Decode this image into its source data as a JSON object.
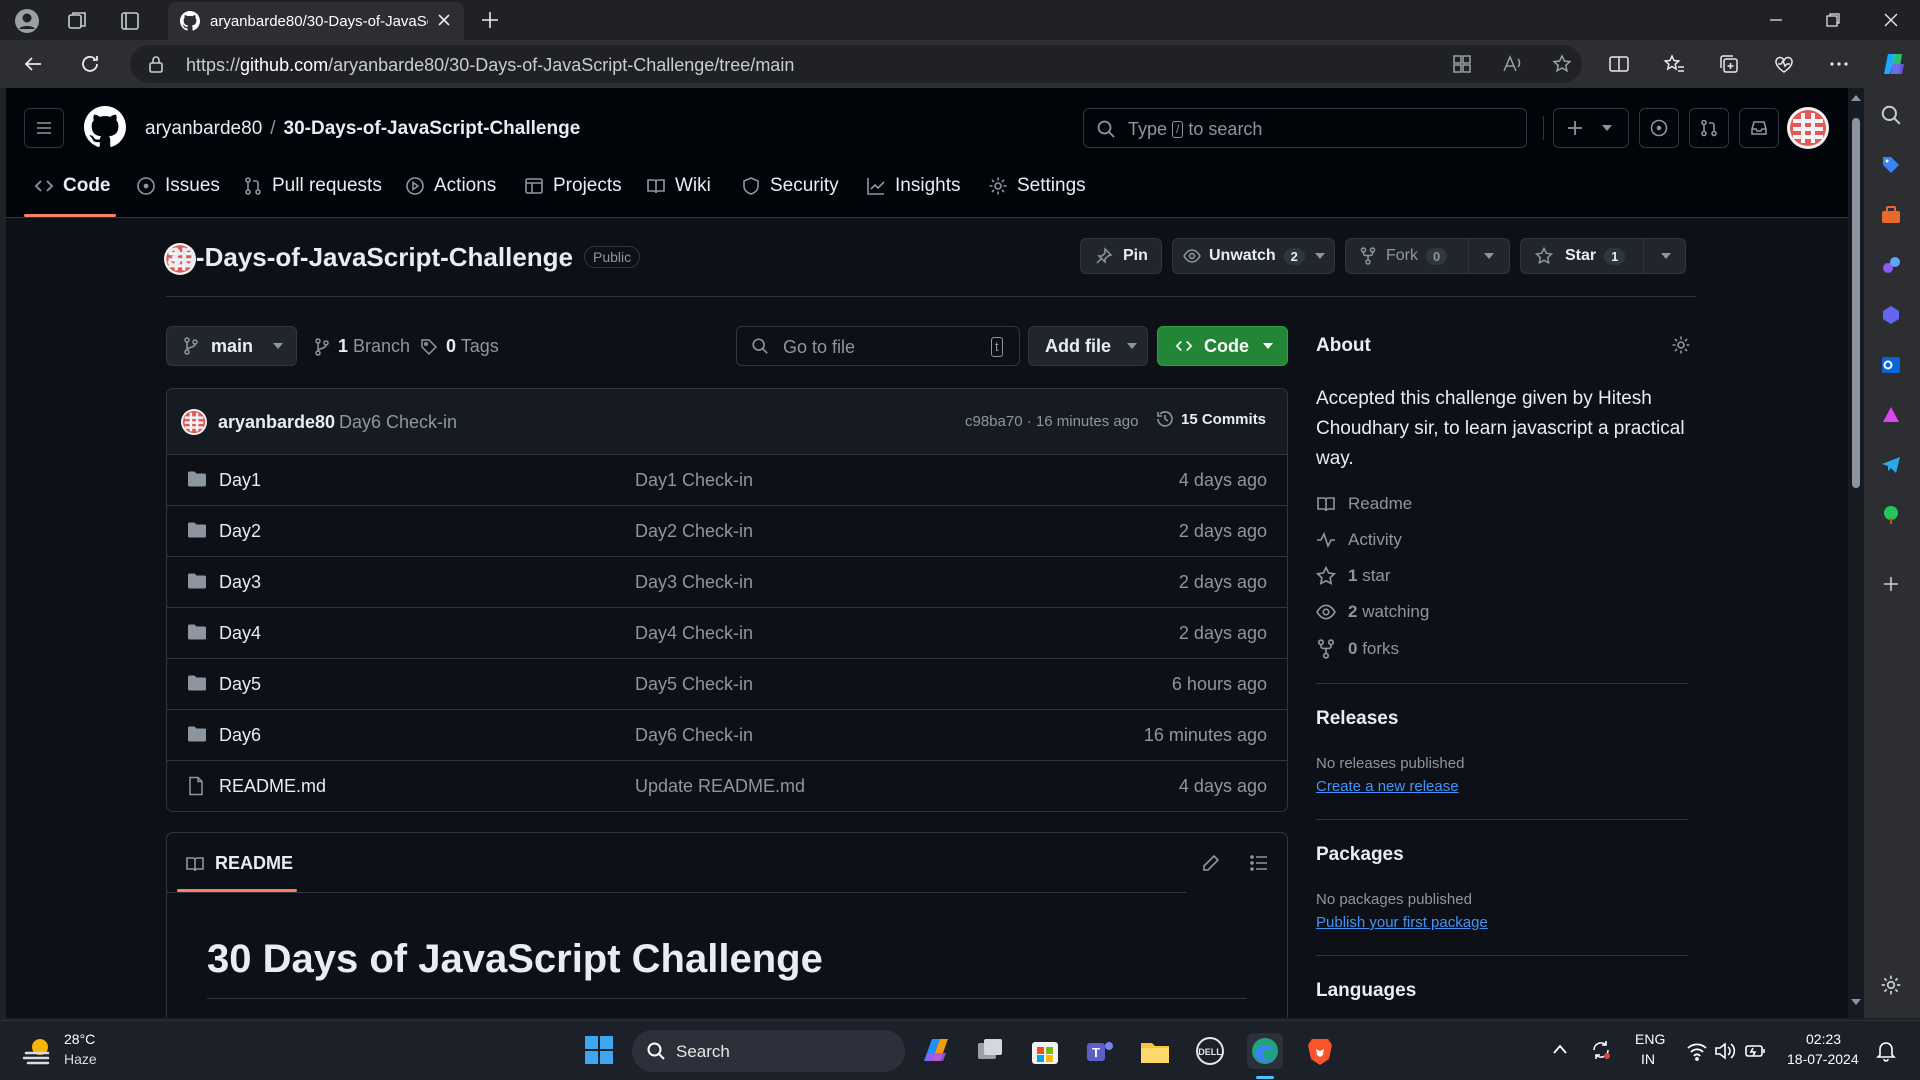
{
  "browser": {
    "tab_title": "aryanbarde80/30-Days-of-JavaSc",
    "url_prefix": "https://",
    "url_host": "github.com",
    "url_path": "/aryanbarde80/30-Days-of-JavaScript-Challenge/tree/main"
  },
  "header": {
    "owner": "aryanbarde80",
    "separator": "/",
    "repo": "30-Days-of-JavaScript-Challenge",
    "search_prefix": "Type",
    "search_key": "/",
    "search_suffix": "to search"
  },
  "nav_tabs": [
    {
      "label": "Code",
      "icon": "code-icon"
    },
    {
      "label": "Issues",
      "icon": "issue-icon"
    },
    {
      "label": "Pull requests",
      "icon": "pull-request-icon"
    },
    {
      "label": "Actions",
      "icon": "play-icon"
    },
    {
      "label": "Projects",
      "icon": "table-icon"
    },
    {
      "label": "Wiki",
      "icon": "book-icon"
    },
    {
      "label": "Security",
      "icon": "shield-icon"
    },
    {
      "label": "Insights",
      "icon": "graph-icon"
    },
    {
      "label": "Settings",
      "icon": "gear-icon"
    }
  ],
  "repo": {
    "title": "30-Days-of-JavaScript-Challenge",
    "visibility": "Public",
    "pin_label": "Pin",
    "unwatch_label": "Unwatch",
    "watch_count": "2",
    "fork_label": "Fork",
    "fork_count": "0",
    "star_label": "Star",
    "star_count": "1"
  },
  "toolbar": {
    "branch": "main",
    "branch_count": "1",
    "branch_label": "Branch",
    "tag_count": "0",
    "tag_label": "Tags",
    "goto_placeholder": "Go to file",
    "goto_key": "t",
    "add_file": "Add file",
    "code_button": "Code"
  },
  "latest_commit": {
    "author": "aryanbarde80",
    "message": "Day6 Check-in",
    "hash_time": "c98ba70 · 16 minutes ago",
    "commits_label": "15 Commits"
  },
  "files": [
    {
      "name": "Day1",
      "type": "folder",
      "message": "Day1 Check-in",
      "time": "4 days ago"
    },
    {
      "name": "Day2",
      "type": "folder",
      "message": "Day2 Check-in",
      "time": "2 days ago"
    },
    {
      "name": "Day3",
      "type": "folder",
      "message": "Day3 Check-in",
      "time": "2 days ago"
    },
    {
      "name": "Day4",
      "type": "folder",
      "message": "Day4 Check-in",
      "time": "2 days ago"
    },
    {
      "name": "Day5",
      "type": "folder",
      "message": "Day5 Check-in",
      "time": "6 hours ago"
    },
    {
      "name": "Day6",
      "type": "folder",
      "message": "Day6 Check-in",
      "time": "16 minutes ago"
    },
    {
      "name": "README.md",
      "type": "file",
      "message": "Update README.md",
      "time": "4 days ago"
    }
  ],
  "readme": {
    "tab_label": "README",
    "heading": "30 Days of JavaScript Challenge"
  },
  "about": {
    "heading": "About",
    "description": "Accepted this challenge given by Hitesh Choudhary sir, to learn javascript a practical way.",
    "readme": "Readme",
    "activity": "Activity",
    "stars_count": "1",
    "stars_label": "star",
    "watching_count": "2",
    "watching_label": "watching",
    "forks_count": "0",
    "forks_label": "forks"
  },
  "releases": {
    "heading": "Releases",
    "empty": "No releases published",
    "link": "Create a new release"
  },
  "packages": {
    "heading": "Packages",
    "empty": "No packages published",
    "link": "Publish your first package"
  },
  "languages": {
    "heading": "Languages"
  },
  "taskbar": {
    "temperature": "28°C",
    "weather": "Haze",
    "search_label": "Search",
    "lang_top": "ENG",
    "lang_bottom": "IN",
    "time": "02:23",
    "date": "18-07-2024"
  },
  "colors": {
    "accent_tab": "#f78166",
    "code_button": "#238636",
    "link": "#4493f8"
  }
}
